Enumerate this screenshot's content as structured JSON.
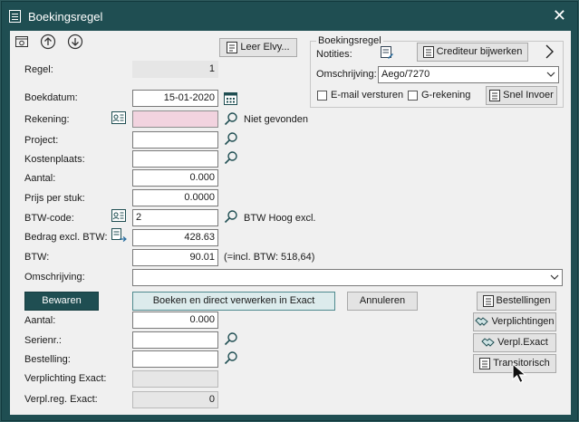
{
  "window": {
    "title": "Boekingsregel",
    "close_glyph": "✕"
  },
  "toolbar": {
    "icons": [
      "settings-icon",
      "arrow-up-icon",
      "arrow-down-icon"
    ],
    "leer_label": "Leer Elvy..."
  },
  "group": {
    "legend": "Boekingsregel",
    "notities_label": "Notities:",
    "crediteur_label": "Crediteur bijwerken",
    "omschrijving_label": "Omschrijving:",
    "omschrijving_value": "Aego/7270",
    "email_label": "E-mail versturen",
    "g_rekening_label": "G-rekening",
    "snel_invoer_label": "Snel Invoer"
  },
  "form": {
    "regel_label": "Regel:",
    "regel_value": "1",
    "boekdatum_label": "Boekdatum:",
    "boekdatum_value": "15-01-2020",
    "rekening_label": "Rekening:",
    "rekening_value": "",
    "rekening_status": "Niet gevonden",
    "project_label": "Project:",
    "project_value": "",
    "kostenplaats_label": "Kostenplaats:",
    "kostenplaats_value": "",
    "aantal_label": "Aantal:",
    "aantal_value": "0.000",
    "prijs_label": "Prijs per stuk:",
    "prijs_value": "0.0000",
    "btw_code_label": "BTW-code:",
    "btw_code_value": "2",
    "btw_code_desc": "BTW Hoog excl.",
    "bedrag_label": "Bedrag excl. BTW:",
    "bedrag_value": "428.63",
    "btw_label": "BTW:",
    "btw_value": "90.01",
    "btw_note": "(=incl. BTW: 518,64)",
    "omschrijving_label": "Omschrijving:",
    "omschrijving_value": ""
  },
  "actions": {
    "bewaren": "Bewaren",
    "boeken": "Boeken en direct verwerken in Exact",
    "annuleren": "Annuleren"
  },
  "side_buttons": {
    "bestellingen": "Bestellingen",
    "verplichtingen": "Verplichtingen",
    "verpl_exact": "Verpl.Exact",
    "transitorisch": "Transitorisch"
  },
  "lower": {
    "aantal_label": "Aantal:",
    "aantal_value": "0.000",
    "serienr_label": "Serienr.:",
    "serienr_value": "",
    "bestelling_label": "Bestelling:",
    "bestelling_value": "",
    "verplichting_label": "Verplichting Exact:",
    "verplichting_value": "",
    "verplreg_label": "Verpl.reg. Exact:",
    "verplreg_value": "0"
  },
  "colors": {
    "titlebar": "#1f4e52",
    "dialog_bg": "#f0f0f0",
    "error_field": "#f2d3df",
    "primary_button": "#1f4e52"
  }
}
